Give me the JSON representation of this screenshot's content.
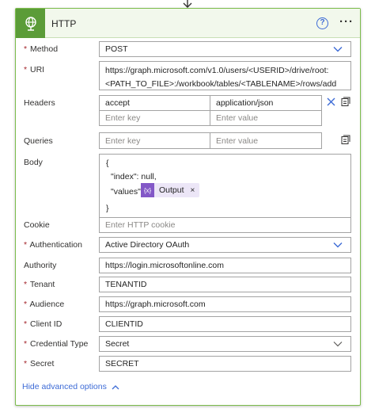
{
  "header": {
    "title": "HTTP",
    "help_icon": "?",
    "more_icon": "···"
  },
  "fields": {
    "method": {
      "label": "Method",
      "value": "POST"
    },
    "uri": {
      "label": "URI",
      "line1": "https://graph.microsoft.com/v1.0/users/<USERID>/drive/root:",
      "line2": "<PATH_TO_FILE>:/workbook/tables/<TABLENAME>/rows/add"
    },
    "headers": {
      "label": "Headers",
      "key": "accept",
      "value": "application/json",
      "key_placeholder": "Enter key",
      "value_placeholder": "Enter value"
    },
    "queries": {
      "label": "Queries",
      "key_placeholder": "Enter key",
      "value_placeholder": "Enter value"
    },
    "body": {
      "label": "Body",
      "line1": "{",
      "line2": "\"index\": null,",
      "line3": "\"values\":",
      "line4": "}",
      "token": "Output",
      "token_icon": "{x}",
      "token_close": "×"
    },
    "cookie": {
      "label": "Cookie",
      "placeholder": "Enter HTTP cookie"
    },
    "authentication": {
      "label": "Authentication",
      "value": "Active Directory OAuth"
    },
    "authority": {
      "label": "Authority",
      "value": "https://login.microsoftonline.com"
    },
    "tenant": {
      "label": "Tenant",
      "value": "TENANTID"
    },
    "audience": {
      "label": "Audience",
      "value": "https://graph.microsoft.com"
    },
    "client_id": {
      "label": "Client ID",
      "value": "CLIENTID"
    },
    "credential_type": {
      "label": "Credential Type",
      "value": "Secret"
    },
    "secret": {
      "label": "Secret",
      "value": "SECRET"
    }
  },
  "footer": {
    "hide_advanced": "Hide advanced options"
  },
  "colors": {
    "accent": "#3d6bd6",
    "header_bg": "#f2f8ec",
    "icon_bg": "#5b9c38",
    "token_bg": "#ece6f7",
    "token_icon_bg": "#8358c7",
    "required": "#a4262c"
  }
}
